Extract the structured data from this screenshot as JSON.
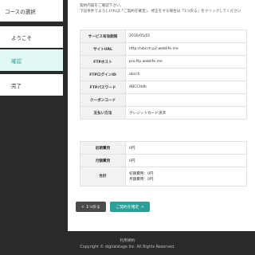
{
  "steps": [
    {
      "label": "コースの選択"
    },
    {
      "label": "ようこそ"
    },
    {
      "label": "確認"
    },
    {
      "label": "完了"
    }
  ],
  "intro": {
    "line1": "契約内容をご確認下さい。",
    "line2": "下記条件でよろしければ「ご契約を確定」、修正をする場合は「1つ戻る」をクリックしてください"
  },
  "details": [
    {
      "label": "サービス有効期限",
      "value": "2016/05/01"
    },
    {
      "label": "サイトURL",
      "value": "http://abcch.p2.weblife.me"
    },
    {
      "label": "FTPホスト",
      "value": "pro.ftp.weblife.me"
    },
    {
      "label": "FTPログインID",
      "value": "abcch"
    },
    {
      "label": "FTPパスワード",
      "value": "ABCCHdh"
    },
    {
      "label": "クーポンコード",
      "value": ""
    },
    {
      "label": "支払い方法",
      "value": "クレジットカード決済"
    }
  ],
  "fees": {
    "initial": {
      "label": "初期費用",
      "value": "0円"
    },
    "monthly": {
      "label": "月額費用",
      "value": "0円"
    },
    "total": {
      "label": "合計",
      "line1": "初期費用：0円",
      "line2": "月額費用：0円"
    }
  },
  "buttons": {
    "back": "1つ戻る",
    "confirm": "ご契約を確定"
  },
  "icons": {
    "back": "double-chevron-left-icon",
    "confirm": "double-chevron-right-icon"
  },
  "footer": {
    "link": "利用規約",
    "copyright": "Copyright © digitalstage Inc. All Rights Reserved."
  },
  "colors": {
    "accent": "#2aa198",
    "active_step_bg": "#e0f7f4",
    "dark": "#2b2b2b"
  }
}
